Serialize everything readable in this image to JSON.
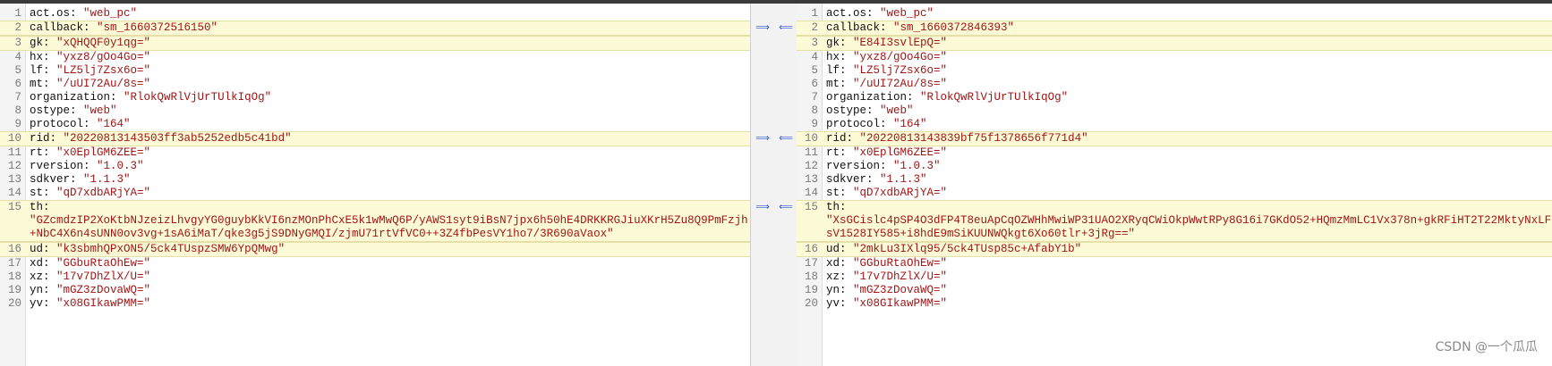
{
  "left": {
    "lines": [
      {
        "n": "1",
        "key": "act.os:",
        "val": "\"web_pc\"",
        "changed": false
      },
      {
        "n": "2",
        "key": "callback:",
        "val": "\"sm_1660372516150\"",
        "changed": true
      },
      {
        "n": "3",
        "key": "gk:",
        "val": "\"xQHQQF0y1qg=\"",
        "changed": true
      },
      {
        "n": "4",
        "key": "hx:",
        "val": "\"yxz8/gOo4Go=\"",
        "changed": false
      },
      {
        "n": "5",
        "key": "lf:",
        "val": "\"LZ5lj7Zsx6o=\"",
        "changed": false
      },
      {
        "n": "6",
        "key": "mt:",
        "val": "\"/uUI72Au/8s=\"",
        "changed": false
      },
      {
        "n": "7",
        "key": "organization:",
        "val": "\"RlokQwRlVjUrTUlkIqOg\"",
        "changed": false
      },
      {
        "n": "8",
        "key": "ostype:",
        "val": "\"web\"",
        "changed": false
      },
      {
        "n": "9",
        "key": "protocol:",
        "val": "\"164\"",
        "changed": false
      },
      {
        "n": "10",
        "key": "rid:",
        "val": "\"20220813143503ff3ab5252edb5c41bd\"",
        "changed": true
      },
      {
        "n": "11",
        "key": "rt:",
        "val": "\"x0EplGM6ZEE=\"",
        "changed": false
      },
      {
        "n": "12",
        "key": "rversion:",
        "val": "\"1.0.3\"",
        "changed": false
      },
      {
        "n": "13",
        "key": "sdkver:",
        "val": "\"1.1.3\"",
        "changed": false
      },
      {
        "n": "14",
        "key": "st:",
        "val": "\"qD7xdbARjYA=\"",
        "changed": false
      },
      {
        "n": "15",
        "key": "th:",
        "val": "\"GZcmdzIP2XoKtbNJzeizLhvgyYG0guybKkVI6nzMOnPhCxE5k1wMwQ6P/yAWS1syt9iBsN7jpx6h50hE4DRKKRGJiuXKrH5Zu8Q9PmFzjh+NbC4X6n4sUNN0ov3vg+1sA6iMaT/qke3g5jS9DNyGMQI/zjmU71rtVfVC0++3Z4fbPesVY1ho7/3R690aVaox\"",
        "changed": true,
        "wrap": true
      },
      {
        "n": "16",
        "key": "ud:",
        "val": "\"k3sbmhQPxON5/5ck4TUspzSMW6YpQMwg\"",
        "changed": true
      },
      {
        "n": "17",
        "key": "xd:",
        "val": "\"GGbuRtaOhEw=\"",
        "changed": false
      },
      {
        "n": "18",
        "key": "xz:",
        "val": "\"17v7DhZlX/U=\"",
        "changed": false
      },
      {
        "n": "19",
        "key": "yn:",
        "val": "\"mGZ3zDovaWQ=\"",
        "changed": false
      },
      {
        "n": "20",
        "key": "yv:",
        "val": "\"x08GIkawPMM=\"",
        "changed": false
      }
    ]
  },
  "right": {
    "lines": [
      {
        "n": "1",
        "key": "act.os:",
        "val": "\"web_pc\"",
        "changed": false
      },
      {
        "n": "2",
        "key": "callback:",
        "val": "\"sm_1660372846393\"",
        "changed": true
      },
      {
        "n": "3",
        "key": "gk:",
        "val": "\"E84I3svlEpQ=\"",
        "changed": true
      },
      {
        "n": "4",
        "key": "hx:",
        "val": "\"yxz8/gOo4Go=\"",
        "changed": false
      },
      {
        "n": "5",
        "key": "lf:",
        "val": "\"LZ5lj7Zsx6o=\"",
        "changed": false
      },
      {
        "n": "6",
        "key": "mt:",
        "val": "\"/uUI72Au/8s=\"",
        "changed": false
      },
      {
        "n": "7",
        "key": "organization:",
        "val": "\"RlokQwRlVjUrTUlkIqOg\"",
        "changed": false
      },
      {
        "n": "8",
        "key": "ostype:",
        "val": "\"web\"",
        "changed": false
      },
      {
        "n": "9",
        "key": "protocol:",
        "val": "\"164\"",
        "changed": false
      },
      {
        "n": "10",
        "key": "rid:",
        "val": "\"20220813143839bf75f1378656f771d4\"",
        "changed": true
      },
      {
        "n": "11",
        "key": "rt:",
        "val": "\"x0EplGM6ZEE=\"",
        "changed": false
      },
      {
        "n": "12",
        "key": "rversion:",
        "val": "\"1.0.3\"",
        "changed": false
      },
      {
        "n": "13",
        "key": "sdkver:",
        "val": "\"1.1.3\"",
        "changed": false
      },
      {
        "n": "14",
        "key": "st:",
        "val": "\"qD7xdbARjYA=\"",
        "changed": false
      },
      {
        "n": "15",
        "key": "th:",
        "val": "\"XsGCislc4pSP4O3dFP4T8euApCqOZWHhMwiWP31UAO2XRyqCWiOkpWwtRPy8G16i7GKdO52+HQmzMmLC1Vx378n+gkRFiHT2T22MktyNxLFsV1528IY585+i8hdE9mSiKUUNWQkgt6Xo60tlr+3jRg==\"",
        "changed": true,
        "wrap": true
      },
      {
        "n": "16",
        "key": "ud:",
        "val": "\"2mkLu3IXlq95/5ck4TUsp85c+AfabY1b\"",
        "changed": true
      },
      {
        "n": "17",
        "key": "xd:",
        "val": "\"GGbuRtaOhEw=\"",
        "changed": false
      },
      {
        "n": "18",
        "key": "xz:",
        "val": "\"17v7DhZlX/U=\"",
        "changed": false
      },
      {
        "n": "19",
        "key": "yn:",
        "val": "\"mGZ3zDovaWQ=\"",
        "changed": false
      },
      {
        "n": "20",
        "key": "yv:",
        "val": "\"x08GIkawPMM=\"",
        "changed": false
      }
    ]
  },
  "merge_arrows": {
    "copy_right": "⟹",
    "copy_left": "⟸"
  },
  "watermark": "CSDN @一个瓜瓜"
}
